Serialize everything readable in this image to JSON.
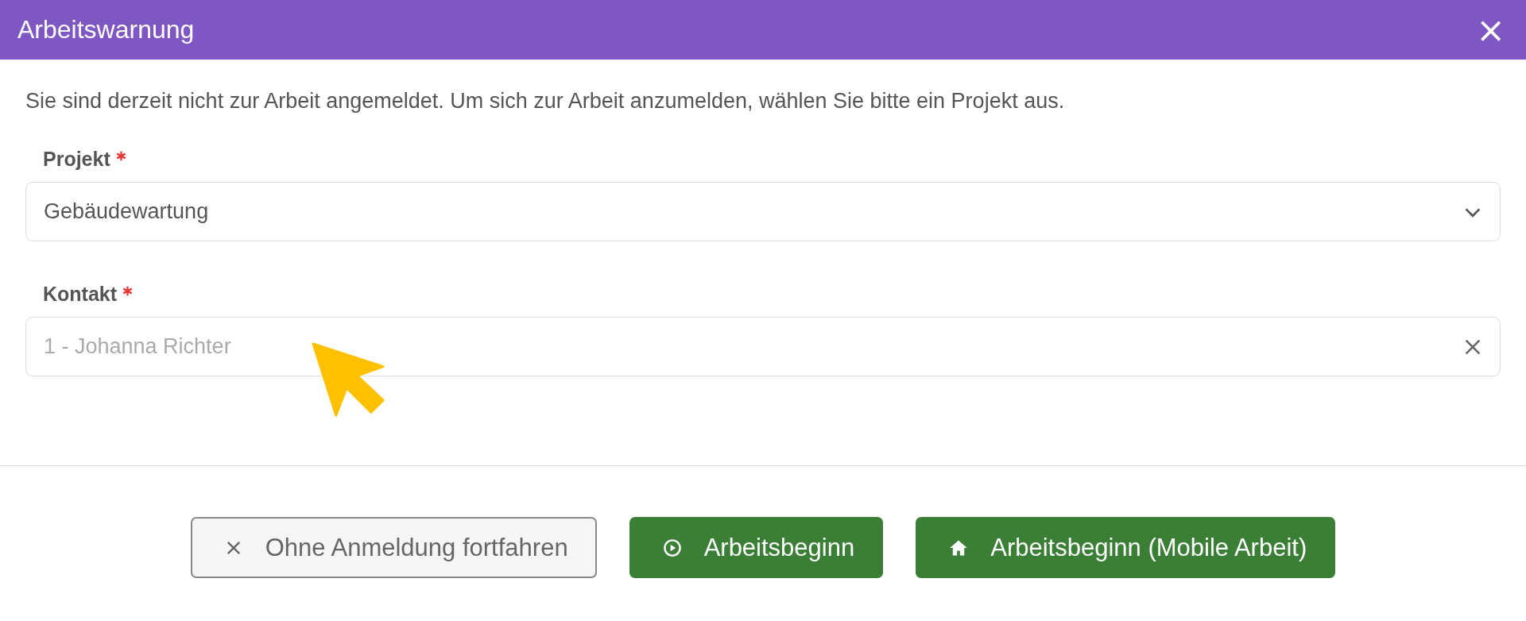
{
  "window": {
    "title": "Arbeitswarnung",
    "close_icon": "×"
  },
  "message": "Sie sind derzeit nicht zur Arbeit angemeldet. Um sich zur Arbeit anzumelden, wählen Sie bitte ein Projekt aus.",
  "fields": [
    {
      "label": "Projekt",
      "required": true,
      "kind": "select",
      "value": "Gebäudewartung"
    },
    {
      "label": "Kontakt",
      "required": true,
      "kind": "clearable",
      "placeholder": "1 - Johanna Richter"
    }
  ],
  "buttons": [
    {
      "label": "Ohne Anmeldung fortfahren",
      "kind": "outline"
    },
    {
      "label": "Arbeitsbeginn",
      "kind": "primary"
    },
    {
      "label": "Arbeitsbeginn (Mobile Arbeit)",
      "kind": "primary"
    }
  ]
}
